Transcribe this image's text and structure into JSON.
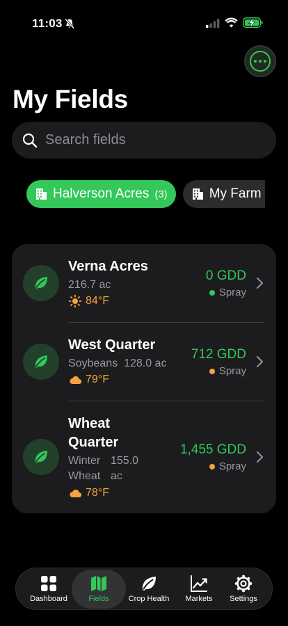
{
  "status_bar": {
    "time": "11:03",
    "icons": [
      "bell-slash-icon",
      "cellular-signal-icon",
      "wifi-icon",
      "battery-charging-icon"
    ]
  },
  "header": {
    "title": "My Fields",
    "more_icon": "ellipsis-circle-icon"
  },
  "search": {
    "placeholder": "Search fields",
    "value": ""
  },
  "farms": [
    {
      "name": "Halverson Acres",
      "count": "(3)",
      "active": true
    },
    {
      "name": "My Farm",
      "active": false
    }
  ],
  "fields": [
    {
      "name": "Verna Acres",
      "crop": "",
      "acres": "216.7 ac",
      "temp": "84°F",
      "weather_icon": "sun-icon",
      "gdd": "0 GDD",
      "spray": "Spray",
      "spray_color": "#34c759"
    },
    {
      "name": "West Quarter",
      "crop": "Soybeans",
      "acres": "128.0 ac",
      "temp": "79°F",
      "weather_icon": "cloud-icon",
      "gdd": "712 GDD",
      "spray": "Spray",
      "spray_color": "#f4a340"
    },
    {
      "name": "Wheat Quarter",
      "crop": "Winter Wheat",
      "acres": "155.0 ac",
      "temp": "78°F",
      "weather_icon": "cloud-icon",
      "gdd": "1,455 GDD",
      "spray": "Spray",
      "spray_color": "#f4a340"
    }
  ],
  "tabs": [
    {
      "label": "Dashboard",
      "icon": "grid-icon",
      "active": false
    },
    {
      "label": "Fields",
      "icon": "map-icon",
      "active": true
    },
    {
      "label": "Crop Health",
      "icon": "leaf-icon",
      "active": false
    },
    {
      "label": "Markets",
      "icon": "chart-line-icon",
      "active": false
    },
    {
      "label": "Settings",
      "icon": "gear-icon",
      "active": false
    }
  ],
  "colors": {
    "accent": "#34c759",
    "warning": "#f4a340",
    "background": "#000000",
    "card": "#1c1c1e"
  }
}
